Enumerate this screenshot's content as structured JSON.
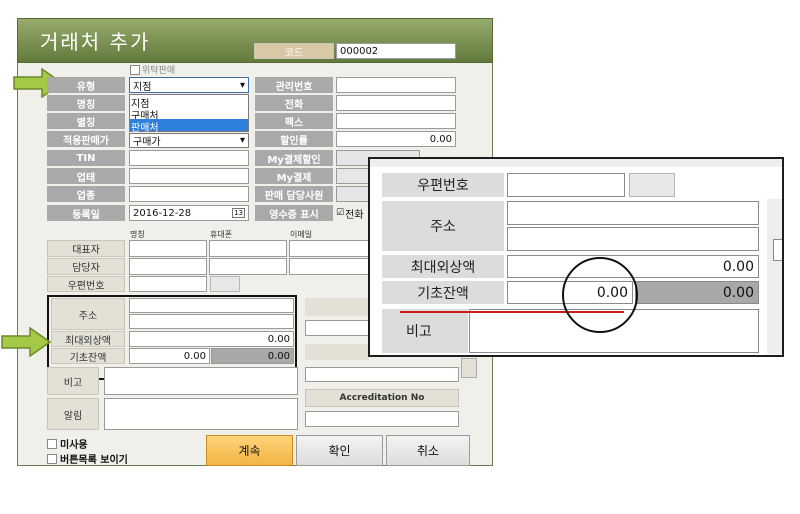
{
  "window": {
    "title": "거래처 추가"
  },
  "code": {
    "label": "코드",
    "value": "000002"
  },
  "consign": {
    "label": "위탁판매"
  },
  "fields": {
    "type": {
      "label": "유형",
      "value": "지점"
    },
    "name": {
      "label": "명칭"
    },
    "alias": {
      "label": "별칭"
    },
    "price_level": {
      "label": "적용판매가",
      "value": "구매가"
    },
    "tin": {
      "label": "TIN"
    },
    "business": {
      "label": "업태"
    },
    "category": {
      "label": "업종"
    },
    "reg_date": {
      "label": "등록일",
      "value": "2016-12-28",
      "cal_icon": "13"
    },
    "manager_no": {
      "label": "관리번호"
    },
    "phone": {
      "label": "전화"
    },
    "fax": {
      "label": "팩스"
    },
    "discount": {
      "label": "할인률",
      "value": "0.00"
    },
    "my_pay_discount": {
      "label": "My결제할인"
    },
    "my_pay": {
      "label": "My결제"
    },
    "sales_rep": {
      "label": "판매 담당사원"
    },
    "receipt": {
      "label": "영수증 표시",
      "phone_check": "전화"
    }
  },
  "dropdown_options": [
    "지점",
    "구매처",
    "판매처"
  ],
  "contact": {
    "col_headers": [
      "명칭",
      "휴대폰",
      "이메일"
    ],
    "rows": [
      "대표자",
      "담당자"
    ]
  },
  "address": {
    "zip_label": "우편번호",
    "addr_label": "주소",
    "max_credit_label": "최대외상액",
    "max_credit_value": "0.00",
    "opening_label": "기초잔액",
    "opening_value": "0.00",
    "opening_gray_value": "0.00"
  },
  "memo": {
    "label": "비고"
  },
  "alert": {
    "label": "알림"
  },
  "accreditation": {
    "label": "Accreditation No"
  },
  "checkboxes": {
    "unused": "미사용",
    "show_buttons": "버튼목록 보이기"
  },
  "buttons": {
    "continue": "계속",
    "confirm": "확인",
    "cancel": "취소"
  },
  "colors": {
    "title_bar": "#7b9450",
    "arrow": "#a3c947",
    "continue_btn": "#f7c35c",
    "red_line": "#d11a1a"
  }
}
